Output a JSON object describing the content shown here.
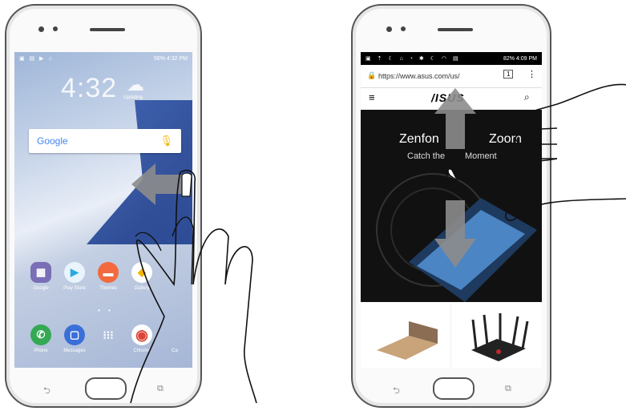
{
  "left_phone": {
    "status_left": "▣ ▤ ▶ ⌂",
    "status_right": "56% 4:32 PM",
    "clock": "4:32",
    "weather": "Updating",
    "search": {
      "logo": "Google"
    },
    "apps_row1": [
      {
        "label": "Google",
        "color": "#7a6fb6",
        "glyph": "▦"
      },
      {
        "label": "Play Store",
        "color": "#2aa9e0",
        "glyph": "▶"
      },
      {
        "label": "Themes",
        "color": "#f26a3d",
        "glyph": "▬"
      },
      {
        "label": "Gallery",
        "color": "#f4b400",
        "glyph": "◆"
      }
    ],
    "apps_row2": [
      {
        "label": "Phone",
        "color": "#34a853",
        "glyph": "✆"
      },
      {
        "label": "Messages",
        "color": "#3b6fd8",
        "glyph": "▢"
      },
      {
        "label": "",
        "color": "transparent",
        "glyph": "⁝⁝⁝"
      },
      {
        "label": "Chrome",
        "color": "#db4437",
        "glyph": "◉"
      },
      {
        "label": "Ca",
        "color": "transparent",
        "glyph": ""
      }
    ]
  },
  "right_phone": {
    "status_right": "82% 4:09 PM",
    "url": "https://www.asus.com/us/",
    "tab_count": "1",
    "brand": "/ISUS",
    "hero_title_a": "Zenfon",
    "hero_title_b": "Zoom",
    "hero_sub_a": "Catch the",
    "hero_sub_b": "Moment"
  },
  "colors": {
    "phone_outline": "#555555",
    "arrow": "#8c8c8c",
    "hero_bg": "#111111"
  }
}
